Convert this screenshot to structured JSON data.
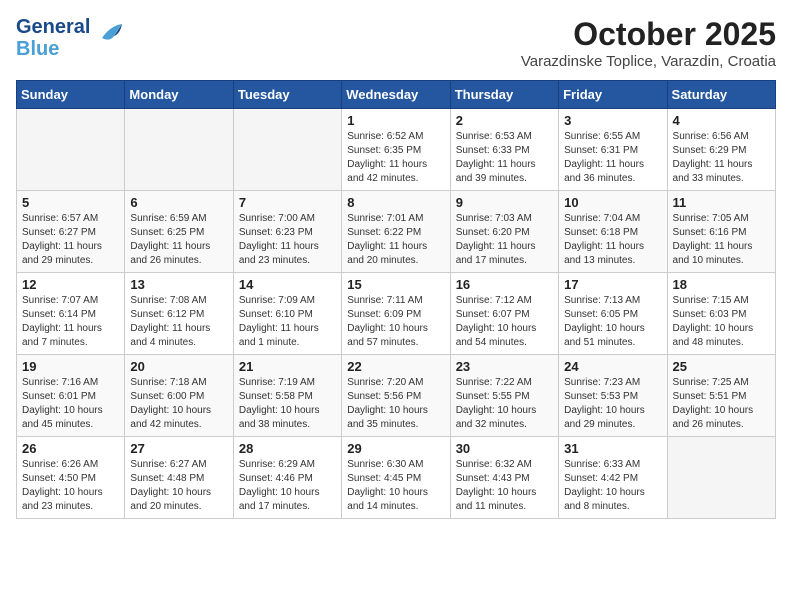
{
  "header": {
    "logo_line1": "General",
    "logo_line2": "Blue",
    "month_year": "October 2025",
    "location": "Varazdinske Toplice, Varazdin, Croatia"
  },
  "days_of_week": [
    "Sunday",
    "Monday",
    "Tuesday",
    "Wednesday",
    "Thursday",
    "Friday",
    "Saturday"
  ],
  "weeks": [
    [
      {
        "day": "",
        "info": ""
      },
      {
        "day": "",
        "info": ""
      },
      {
        "day": "",
        "info": ""
      },
      {
        "day": "1",
        "info": "Sunrise: 6:52 AM\nSunset: 6:35 PM\nDaylight: 11 hours\nand 42 minutes."
      },
      {
        "day": "2",
        "info": "Sunrise: 6:53 AM\nSunset: 6:33 PM\nDaylight: 11 hours\nand 39 minutes."
      },
      {
        "day": "3",
        "info": "Sunrise: 6:55 AM\nSunset: 6:31 PM\nDaylight: 11 hours\nand 36 minutes."
      },
      {
        "day": "4",
        "info": "Sunrise: 6:56 AM\nSunset: 6:29 PM\nDaylight: 11 hours\nand 33 minutes."
      }
    ],
    [
      {
        "day": "5",
        "info": "Sunrise: 6:57 AM\nSunset: 6:27 PM\nDaylight: 11 hours\nand 29 minutes."
      },
      {
        "day": "6",
        "info": "Sunrise: 6:59 AM\nSunset: 6:25 PM\nDaylight: 11 hours\nand 26 minutes."
      },
      {
        "day": "7",
        "info": "Sunrise: 7:00 AM\nSunset: 6:23 PM\nDaylight: 11 hours\nand 23 minutes."
      },
      {
        "day": "8",
        "info": "Sunrise: 7:01 AM\nSunset: 6:22 PM\nDaylight: 11 hours\nand 20 minutes."
      },
      {
        "day": "9",
        "info": "Sunrise: 7:03 AM\nSunset: 6:20 PM\nDaylight: 11 hours\nand 17 minutes."
      },
      {
        "day": "10",
        "info": "Sunrise: 7:04 AM\nSunset: 6:18 PM\nDaylight: 11 hours\nand 13 minutes."
      },
      {
        "day": "11",
        "info": "Sunrise: 7:05 AM\nSunset: 6:16 PM\nDaylight: 11 hours\nand 10 minutes."
      }
    ],
    [
      {
        "day": "12",
        "info": "Sunrise: 7:07 AM\nSunset: 6:14 PM\nDaylight: 11 hours\nand 7 minutes."
      },
      {
        "day": "13",
        "info": "Sunrise: 7:08 AM\nSunset: 6:12 PM\nDaylight: 11 hours\nand 4 minutes."
      },
      {
        "day": "14",
        "info": "Sunrise: 7:09 AM\nSunset: 6:10 PM\nDaylight: 11 hours\nand 1 minute."
      },
      {
        "day": "15",
        "info": "Sunrise: 7:11 AM\nSunset: 6:09 PM\nDaylight: 10 hours\nand 57 minutes."
      },
      {
        "day": "16",
        "info": "Sunrise: 7:12 AM\nSunset: 6:07 PM\nDaylight: 10 hours\nand 54 minutes."
      },
      {
        "day": "17",
        "info": "Sunrise: 7:13 AM\nSunset: 6:05 PM\nDaylight: 10 hours\nand 51 minutes."
      },
      {
        "day": "18",
        "info": "Sunrise: 7:15 AM\nSunset: 6:03 PM\nDaylight: 10 hours\nand 48 minutes."
      }
    ],
    [
      {
        "day": "19",
        "info": "Sunrise: 7:16 AM\nSunset: 6:01 PM\nDaylight: 10 hours\nand 45 minutes."
      },
      {
        "day": "20",
        "info": "Sunrise: 7:18 AM\nSunset: 6:00 PM\nDaylight: 10 hours\nand 42 minutes."
      },
      {
        "day": "21",
        "info": "Sunrise: 7:19 AM\nSunset: 5:58 PM\nDaylight: 10 hours\nand 38 minutes."
      },
      {
        "day": "22",
        "info": "Sunrise: 7:20 AM\nSunset: 5:56 PM\nDaylight: 10 hours\nand 35 minutes."
      },
      {
        "day": "23",
        "info": "Sunrise: 7:22 AM\nSunset: 5:55 PM\nDaylight: 10 hours\nand 32 minutes."
      },
      {
        "day": "24",
        "info": "Sunrise: 7:23 AM\nSunset: 5:53 PM\nDaylight: 10 hours\nand 29 minutes."
      },
      {
        "day": "25",
        "info": "Sunrise: 7:25 AM\nSunset: 5:51 PM\nDaylight: 10 hours\nand 26 minutes."
      }
    ],
    [
      {
        "day": "26",
        "info": "Sunrise: 6:26 AM\nSunset: 4:50 PM\nDaylight: 10 hours\nand 23 minutes."
      },
      {
        "day": "27",
        "info": "Sunrise: 6:27 AM\nSunset: 4:48 PM\nDaylight: 10 hours\nand 20 minutes."
      },
      {
        "day": "28",
        "info": "Sunrise: 6:29 AM\nSunset: 4:46 PM\nDaylight: 10 hours\nand 17 minutes."
      },
      {
        "day": "29",
        "info": "Sunrise: 6:30 AM\nSunset: 4:45 PM\nDaylight: 10 hours\nand 14 minutes."
      },
      {
        "day": "30",
        "info": "Sunrise: 6:32 AM\nSunset: 4:43 PM\nDaylight: 10 hours\nand 11 minutes."
      },
      {
        "day": "31",
        "info": "Sunrise: 6:33 AM\nSunset: 4:42 PM\nDaylight: 10 hours\nand 8 minutes."
      },
      {
        "day": "",
        "info": ""
      }
    ]
  ]
}
